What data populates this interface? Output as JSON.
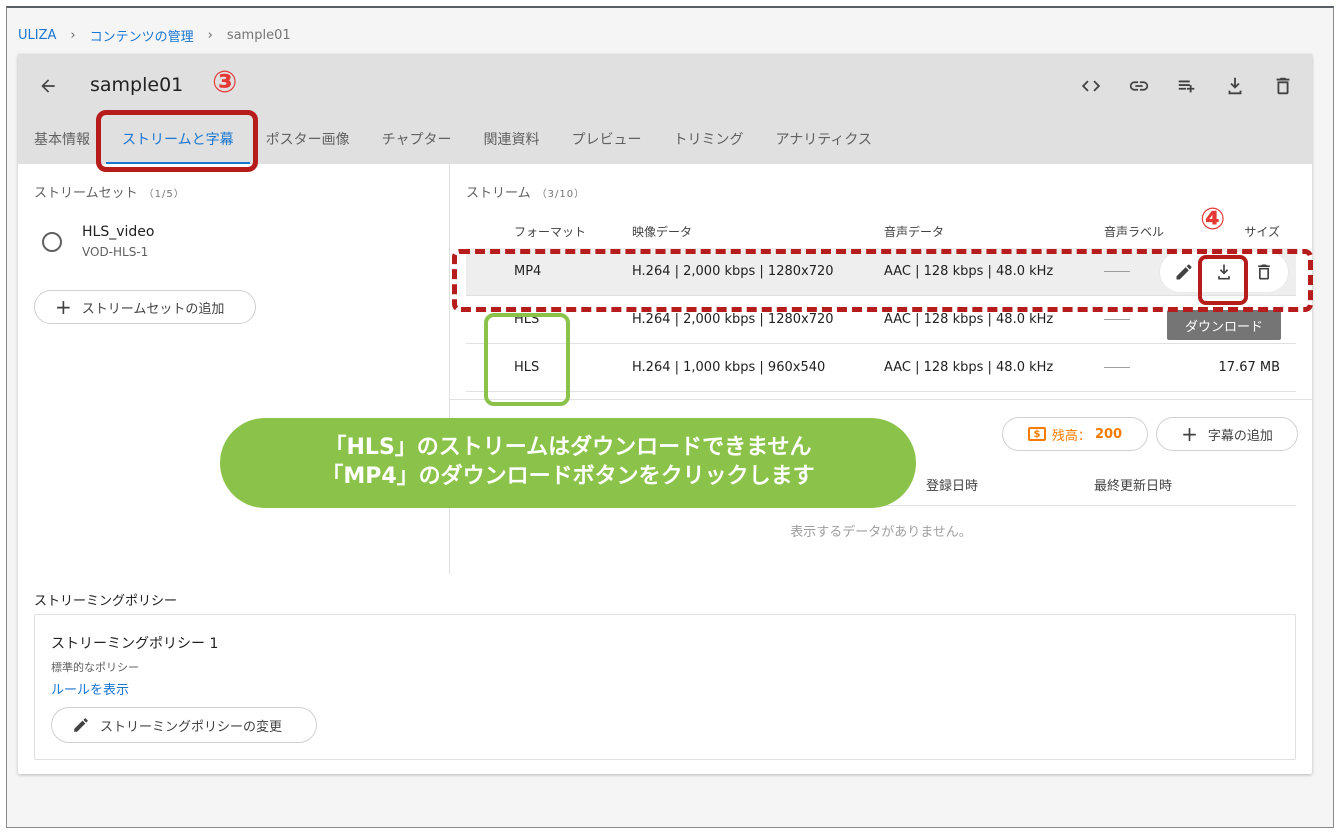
{
  "breadcrumb": {
    "root": "ULIZA",
    "section": "コンテンツの管理",
    "current": "sample01",
    "separator": "›"
  },
  "header": {
    "title": "sample01",
    "back_icon": "arrow-left-icon",
    "icons": [
      "code-icon",
      "link-icon",
      "playlist-add-icon",
      "download-icon",
      "delete-icon"
    ]
  },
  "tabs": [
    {
      "label": "基本情報"
    },
    {
      "label": "ストリームと字幕",
      "active": true
    },
    {
      "label": "ポスター画像"
    },
    {
      "label": "チャプター"
    },
    {
      "label": "関連資料"
    },
    {
      "label": "プレビュー"
    },
    {
      "label": "トリミング"
    },
    {
      "label": "アナリティクス"
    }
  ],
  "stream_sets": {
    "title": "ストリームセット",
    "count": "（1/5）",
    "items": [
      {
        "name": "HLS_video",
        "sub": "VOD-HLS-1"
      }
    ],
    "add_label": "ストリームセットの追加"
  },
  "streams": {
    "title": "ストリーム",
    "count": "（3/10）",
    "columns": {
      "format": "フォーマット",
      "video": "映像データ",
      "audio": "音声データ",
      "label": "音声ラベル",
      "size": "サイズ"
    },
    "rows": [
      {
        "format": "MP4",
        "video": "H.264 | 2,000 kbps | 1280x720",
        "audio": "AAC | 128 kbps | 48.0 kHz",
        "size": ""
      },
      {
        "format": "HLS",
        "video": "H.264 | 2,000 kbps | 1280x720",
        "audio": "AAC | 128 kbps | 48.0 kHz",
        "size": ""
      },
      {
        "format": "HLS",
        "video": "H.264 | 1,000 kbps | 960x540",
        "audio": "AAC | 128 kbps | 48.0 kHz",
        "size": "17.67 MB"
      }
    ],
    "tooltip": "ダウンロード"
  },
  "subtitles": {
    "balance_label": "残高：",
    "balance_value": "200",
    "add_label": "字幕の追加",
    "columns": {
      "registered": "登録日時",
      "updated": "最終更新日時"
    },
    "empty": "表示するデータがありません。"
  },
  "policy": {
    "section_title": "ストリーミングポリシー",
    "name": "ストリーミングポリシー 1",
    "desc": "標準的なポリシー",
    "link": "ルールを表示",
    "change_label": "ストリーミングポリシーの変更"
  },
  "annotations": {
    "step3": "③",
    "step4": "④",
    "message_line1": "「HLS」のストリームはダウンロードできません",
    "message_line2": "「MP4」のダウンロードボタンをクリックします"
  },
  "colors": {
    "accent": "#1976d2",
    "annotation_red": "#b71c1c",
    "annotation_green": "#8bc34a",
    "balance": "#f57c00"
  }
}
